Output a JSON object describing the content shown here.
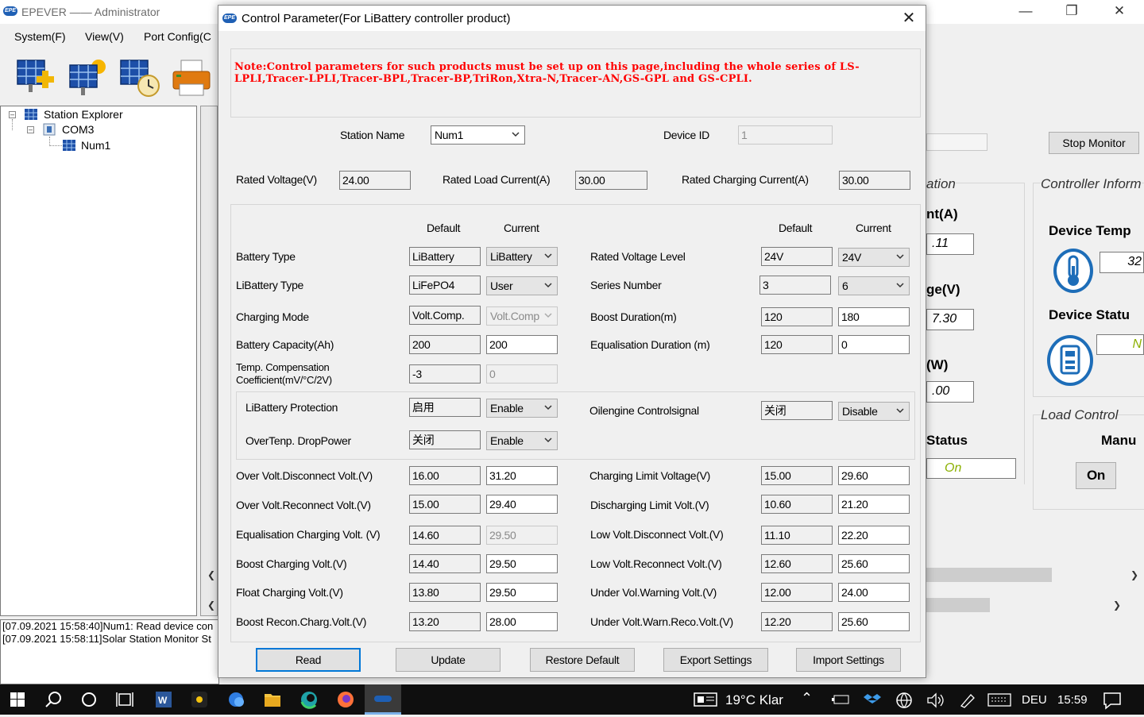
{
  "main_window": {
    "title": "EPEVER —— Administrator",
    "app_logo_text": "EPE",
    "menu": [
      "System(F)",
      "View(V)",
      "Port Config(C"
    ],
    "tree": {
      "root": "Station Explorer",
      "port": "COM3",
      "device": "Num1"
    },
    "log": [
      "[07.09.2021 15:58:40]Num1: Read device con",
      "[07.09.2021 15:58:11]Solar Station Monitor St"
    ],
    "stop_monitor_label": "Stop Monitor",
    "partial_group_title": "ation",
    "partial_labels": {
      "current": "nt(A)",
      "current_value": ".11",
      "voltage": "ge(V)",
      "voltage_value": "7.30",
      "power": "(W)",
      "power_value": ".00",
      "status": "Status",
      "status_value": "On"
    },
    "controller_info_title": "Controller Inform",
    "device_temp_label": "Device Temp",
    "device_temp_value": "32",
    "device_status_label": "Device Statu",
    "device_status_value": "N",
    "load_control_title": "Load Control",
    "load_mode_label": "Manu",
    "load_on_button": "On"
  },
  "dialog": {
    "title": "Control Parameter(For LiBattery controller product)",
    "logo_text": "EPE",
    "note": "Note:Control parameters for such products must be set up on this page,including the whole series of LS-LPLI,Tracer-LPLI,Tracer-BPL,Tracer-BP,TriRon,Xtra-N,Tracer-AN,GS-GPL and GS-CPLI.",
    "station_name_label": "Station Name",
    "station_name_value": "Num1",
    "device_id_label": "Device ID",
    "device_id_value": "1",
    "rated_voltage_label": "Rated Voltage(V)",
    "rated_voltage_value": "24.00",
    "rated_load_current_label": "Rated Load Current(A)",
    "rated_load_current_value": "30.00",
    "rated_charging_current_label": "Rated Charging Current(A)",
    "rated_charging_current_value": "30.00",
    "col_default": "Default",
    "col_current": "Current",
    "left_params": [
      {
        "label": "Battery Type",
        "default": "LiBattery",
        "current": "LiBattery"
      },
      {
        "label": "LiBattery Type",
        "default": "LiFePO4",
        "current": "User"
      },
      {
        "label": "Charging Mode",
        "default": "Volt.Comp.",
        "current": "Volt.Comp"
      },
      {
        "label": "Battery Capacity(Ah)",
        "default": "200",
        "current": "200"
      },
      {
        "label1": "Temp. Compensation",
        "label2": "Coefficient(mV/°C/2V)",
        "default": "-3",
        "current": "0"
      }
    ],
    "right_params": [
      {
        "label": "Rated Voltage Level",
        "default": "24V",
        "current": "24V"
      },
      {
        "label": "Series Number",
        "default": "3",
        "current": "6"
      },
      {
        "label": "Boost Duration(m)",
        "default": "120",
        "current": "180"
      },
      {
        "label": "Equalisation Duration (m)",
        "default": "120",
        "current": "0"
      }
    ],
    "protection": {
      "libattery_label": "LiBattery Protection",
      "libattery_default": "启用",
      "libattery_current": "Enable",
      "overtemp_label": "OverTenp. DropPower",
      "overtemp_default": "关闭",
      "overtemp_current": "Enable",
      "oilengine_label": "Oilengine Controlsignal",
      "oilengine_default": "关闭",
      "oilengine_current": "Disable"
    },
    "volt_left": [
      {
        "label": "Over Volt.Disconnect Volt.(V)",
        "default": "16.00",
        "current": "31.20"
      },
      {
        "label": "Over Volt.Reconnect Volt.(V)",
        "default": "15.00",
        "current": "29.40"
      },
      {
        "label": "Equalisation Charging Volt. (V)",
        "default": "14.60",
        "current": "29.50"
      },
      {
        "label": "Boost Charging Volt.(V)",
        "default": "14.40",
        "current": "29.50"
      },
      {
        "label": "Float Charging Volt.(V)",
        "default": "13.80",
        "current": "29.50"
      },
      {
        "label": "Boost Recon.Charg.Volt.(V)",
        "default": "13.20",
        "current": "28.00"
      }
    ],
    "volt_right": [
      {
        "label": "Charging Limit Voltage(V)",
        "default": "15.00",
        "current": "29.60"
      },
      {
        "label": "Discharging Limit Volt.(V)",
        "default": "10.60",
        "current": "21.20"
      },
      {
        "label": "Low Volt.Disconnect Volt.(V)",
        "default": "11.10",
        "current": "22.20"
      },
      {
        "label": "Low Volt.Reconnect Volt.(V)",
        "default": "12.60",
        "current": "25.60"
      },
      {
        "label": "Under Vol.Warning Volt.(V)",
        "default": "12.00",
        "current": "24.00"
      },
      {
        "label": "Under Volt.Warn.Reco.Volt.(V)",
        "default": "12.20",
        "current": "25.60"
      }
    ],
    "buttons": {
      "read": "Read",
      "update": "Update",
      "restore_default": "Restore Default",
      "export_settings": "Export Settings",
      "import_settings": "Import Settings"
    }
  },
  "taskbar": {
    "weather": "19°C  Klar",
    "language": "DEU",
    "time": "15:59"
  },
  "colors": {
    "note_text": "#ff0000",
    "focus_border": "#0078d7",
    "taskbar": "#0f0f0f",
    "icon_blue": "#1d6db8"
  }
}
